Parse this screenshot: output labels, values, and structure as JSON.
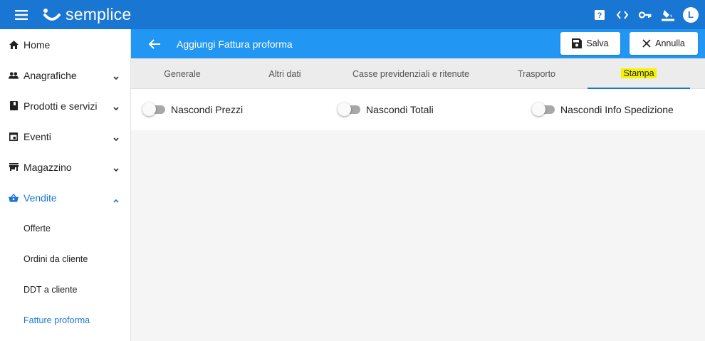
{
  "app": {
    "logo_text": "semplice",
    "brand_color": "#1976d2",
    "header_color": "#2196f3",
    "avatar_letter": "L"
  },
  "top_icons": [
    "help-icon",
    "code-icon",
    "key-icon",
    "paint-bucket-icon"
  ],
  "sidebar": {
    "items": [
      {
        "label": "Home",
        "icon": "home-icon",
        "chevron": ""
      },
      {
        "label": "Anagrafiche",
        "icon": "people-icon",
        "chevron": "down"
      },
      {
        "label": "Prodotti e servizi",
        "icon": "book-icon",
        "chevron": "down"
      },
      {
        "label": "Eventi",
        "icon": "calendar-icon",
        "chevron": "down"
      },
      {
        "label": "Magazzino",
        "icon": "store-icon",
        "chevron": "down"
      },
      {
        "label": "Vendite",
        "icon": "basket-icon",
        "chevron": "up",
        "active": true
      }
    ],
    "sub_items": [
      {
        "label": "Offerte"
      },
      {
        "label": "Ordini da cliente"
      },
      {
        "label": "DDT a cliente"
      },
      {
        "label": "Fatture proforma",
        "active": true
      }
    ]
  },
  "header": {
    "title": "Aggiungi Fattura proforma",
    "save_label": "Salva",
    "cancel_label": "Annulla"
  },
  "tabs": [
    {
      "label": "Generale"
    },
    {
      "label": "Altri dati"
    },
    {
      "label": "Casse previdenziali e ritenute"
    },
    {
      "label": "Trasporto"
    },
    {
      "label": "Stampa",
      "active": true,
      "highlight": "#f4f400"
    }
  ],
  "options": [
    {
      "label": "Nascondi Prezzi",
      "checked": false
    },
    {
      "label": "Nascondi Totali",
      "checked": false
    },
    {
      "label": "Nascondi Info Spedizione",
      "checked": false
    }
  ]
}
